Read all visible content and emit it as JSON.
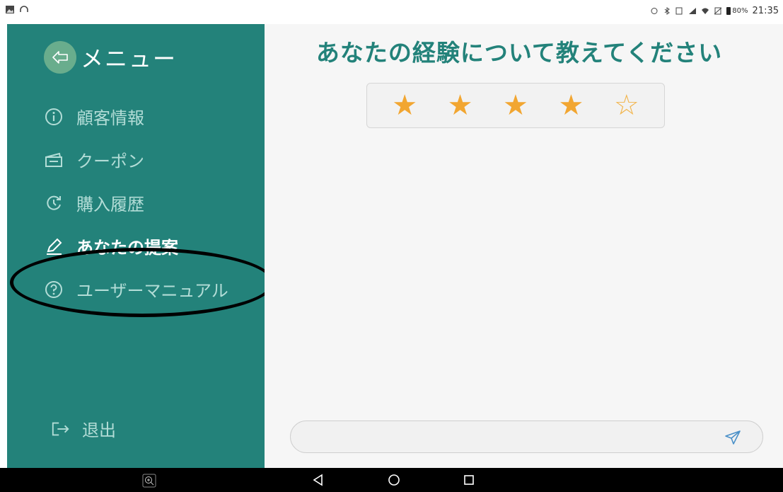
{
  "status_bar": {
    "battery_percent": "80%",
    "time": "21:35"
  },
  "sidebar": {
    "title": "メニュー",
    "items": [
      {
        "label": "顧客情報",
        "icon": "info-icon",
        "active": false
      },
      {
        "label": "クーポン",
        "icon": "coupon-icon",
        "active": false
      },
      {
        "label": "購入履歴",
        "icon": "history-icon",
        "active": false
      },
      {
        "label": "あなたの提案",
        "icon": "pencil-icon",
        "active": true
      },
      {
        "label": "ユーザーマニュアル",
        "icon": "help-icon",
        "active": false
      }
    ],
    "logout_label": "退出"
  },
  "main": {
    "title": "あなたの経験について教えてください",
    "rating": {
      "value": 4,
      "max": 5
    },
    "message_input": {
      "value": "",
      "placeholder": ""
    }
  },
  "colors": {
    "sidebar_bg": "#23827a",
    "accent": "#23827a",
    "star": "#f2a631"
  }
}
